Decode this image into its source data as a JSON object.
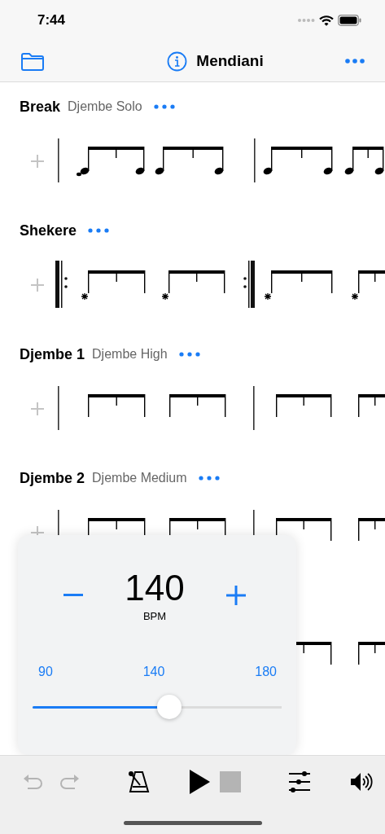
{
  "status_bar": {
    "time": "7:44"
  },
  "nav": {
    "title": "Mendiani"
  },
  "tracks": [
    {
      "name": "Break",
      "instrument": "Djembe Solo",
      "kind": "notes"
    },
    {
      "name": "Shekere",
      "kind": "repeat"
    },
    {
      "name": "Djembe 1",
      "instrument": "Djembe High",
      "kind": "beams"
    },
    {
      "name": "Djembe 2",
      "instrument": "Djembe Medium",
      "kind": "beams"
    },
    {
      "kind": "beams"
    }
  ],
  "tempo_popover": {
    "value": "140",
    "unit": "BPM",
    "min": "90",
    "current": "140",
    "max": "180",
    "level": 0.55
  },
  "toolbar": [
    {
      "kind": "undo",
      "disabled": true
    },
    {
      "kind": "redo",
      "disabled": true
    },
    {
      "kind": "metronome",
      "disabled": false
    },
    {
      "kind": "play",
      "disabled": false
    },
    {
      "kind": "stop",
      "disabled": true
    },
    {
      "kind": "mixer",
      "disabled": false
    },
    {
      "kind": "volume",
      "disabled": false
    }
  ]
}
